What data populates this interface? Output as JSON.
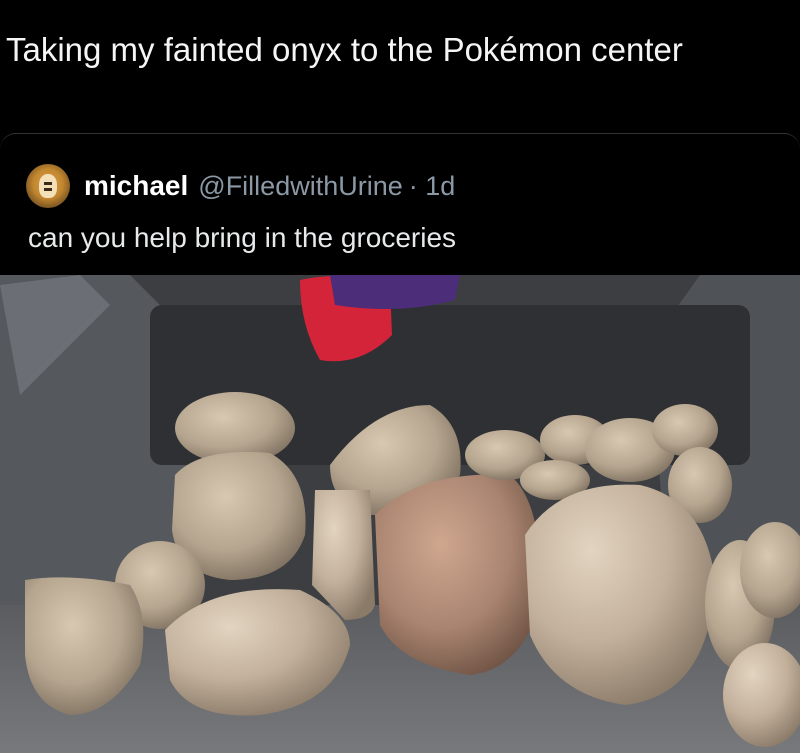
{
  "post": {
    "caption": "Taking my fainted onyx to the Pokémon center"
  },
  "quoted_post": {
    "author": {
      "display_name": "michael",
      "handle": "@FilledwithUrine",
      "age": "· 1d"
    },
    "text": "can you help bring in the groceries"
  },
  "icons": {
    "avatar": "avatar-image"
  },
  "colors": {
    "background": "#000000",
    "text_primary": "#e7e9ea",
    "text_secondary": "#8b98a5"
  }
}
